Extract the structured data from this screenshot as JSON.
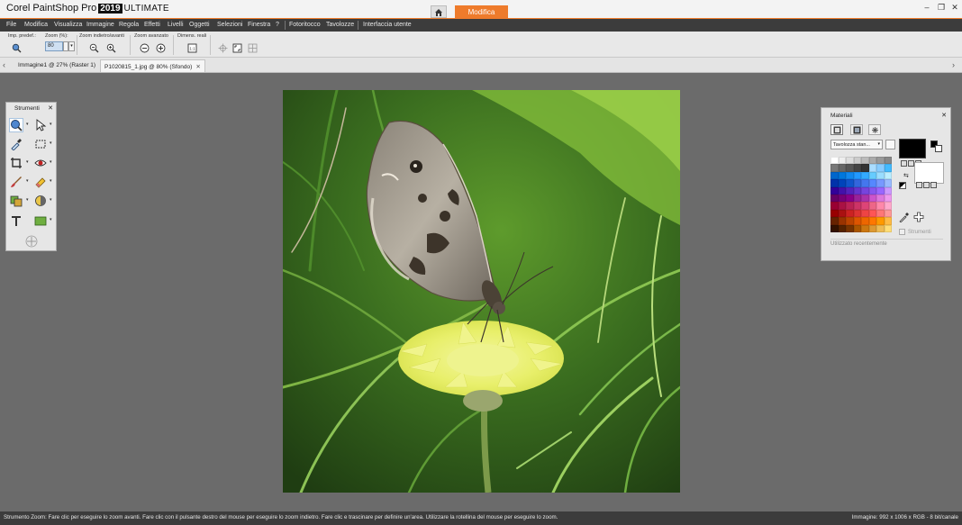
{
  "app": {
    "brand": "Corel PaintShop Pro",
    "version": "2019",
    "edition": "ULTIMATE",
    "home_tab_icon": "home-icon",
    "active_workspace_tab": "Modifica",
    "accent_color": "#ee7b2b"
  },
  "menu": {
    "items": [
      "File",
      "Modifica",
      "Visualizza",
      "Immagine",
      "Regola",
      "Effetti",
      "Livelli",
      "Oggetti",
      "Selezioni",
      "Finestra",
      "?",
      "Fotoritocco",
      "Tavolozze",
      "Interfaccia utente"
    ]
  },
  "toolbar": {
    "preset_label": "Imp. predef.:",
    "zoom_label": "Zoom (%):",
    "zoom_value": "80",
    "zoom_inout_label": "Zoom indietro/avanti",
    "zoom_advanced_label": "Zoom avanzato",
    "actual_size_label": "Dimens. reali"
  },
  "doctabs": [
    {
      "label": "Immagine1 @  27% (Raster 1)",
      "active": false
    },
    {
      "label": "P1020815_1.jpg @  80% (Sfondo)",
      "active": true
    }
  ],
  "tools_panel": {
    "title": "Strumenti",
    "tools": [
      "zoom-icon",
      "pick-icon",
      "dropper-icon",
      "selection-icon",
      "crop-icon",
      "red-eye-icon",
      "brush-icon",
      "eraser-icon",
      "clone-icon",
      "dodge-icon",
      "text-icon",
      "rectangle-icon",
      "move-icon"
    ]
  },
  "materials": {
    "title": "Materiali",
    "palette_select": "Tavolozza stan...",
    "checkbox_label": "Strumenti",
    "recent_label": "Utilizzato recentemente",
    "fg_color": "#000000",
    "bg_color": "#ffffff"
  },
  "status": {
    "left": "Strumento Zoom: Fare clic per eseguire lo zoom avanti. Fare clic con il pulsante destro del mouse per eseguire lo zoom indietro. Fare clic e trascinare per definire un'area. Utilizzare la rotellina del mouse per eseguire lo zoom.",
    "right": "Immagine:  992 x 1006 x RGB - 8 bit/canale"
  }
}
